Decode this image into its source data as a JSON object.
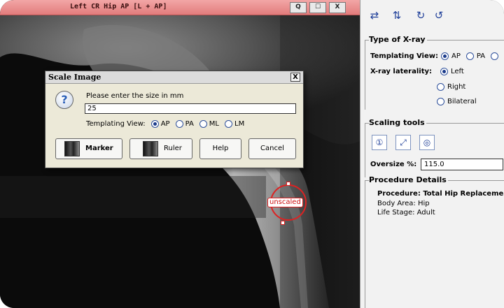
{
  "viewer": {
    "title": "Left CR Hip AP  [L + AP]",
    "buttons": [
      "Q",
      "",
      "X"
    ],
    "overlay_label": "unscaled"
  },
  "dialog": {
    "title": "Scale Image",
    "close": "X",
    "prompt": "Please enter the size in mm",
    "size_value": "25",
    "templating_label": "Templating View:",
    "view_options": [
      "AP",
      "PA",
      "ML",
      "LM"
    ],
    "selected_view": "AP",
    "buttons": {
      "marker": "Marker",
      "ruler": "Ruler",
      "help": "Help",
      "cancel": "Cancel"
    },
    "icon": "?"
  },
  "panel": {
    "toolbar_icons": [
      "flip-horizontal-icon",
      "flip-vertical-icon",
      "rotate-cw-icon",
      "rotate-ccw-icon"
    ],
    "xray_type": {
      "title": "Type of X-ray",
      "templating_label": "Templating View:",
      "view_options": [
        "AP",
        "PA"
      ],
      "selected_view": "AP",
      "laterality_label": "X-ray laterality:",
      "laterality_options": [
        "Left",
        "Right",
        "Bilateral"
      ],
      "selected_laterality": "Left"
    },
    "scaling": {
      "title": "Scaling tools",
      "tool_icons": [
        "marker-scale-icon",
        "ruler-scale-icon",
        "auto-scale-icon"
      ],
      "oversize_label": "Oversize %:",
      "oversize_value": "115.0"
    },
    "procedure": {
      "title": "Procedure Details",
      "procedure": "Procedure: Total Hip Replacement",
      "body_area": "Body Area: Hip",
      "life_stage": "Life Stage: Adult"
    }
  },
  "colors": {
    "titlebar": "#e27c7c",
    "accent": "#1f3f99",
    "overlay": "#d22222"
  }
}
